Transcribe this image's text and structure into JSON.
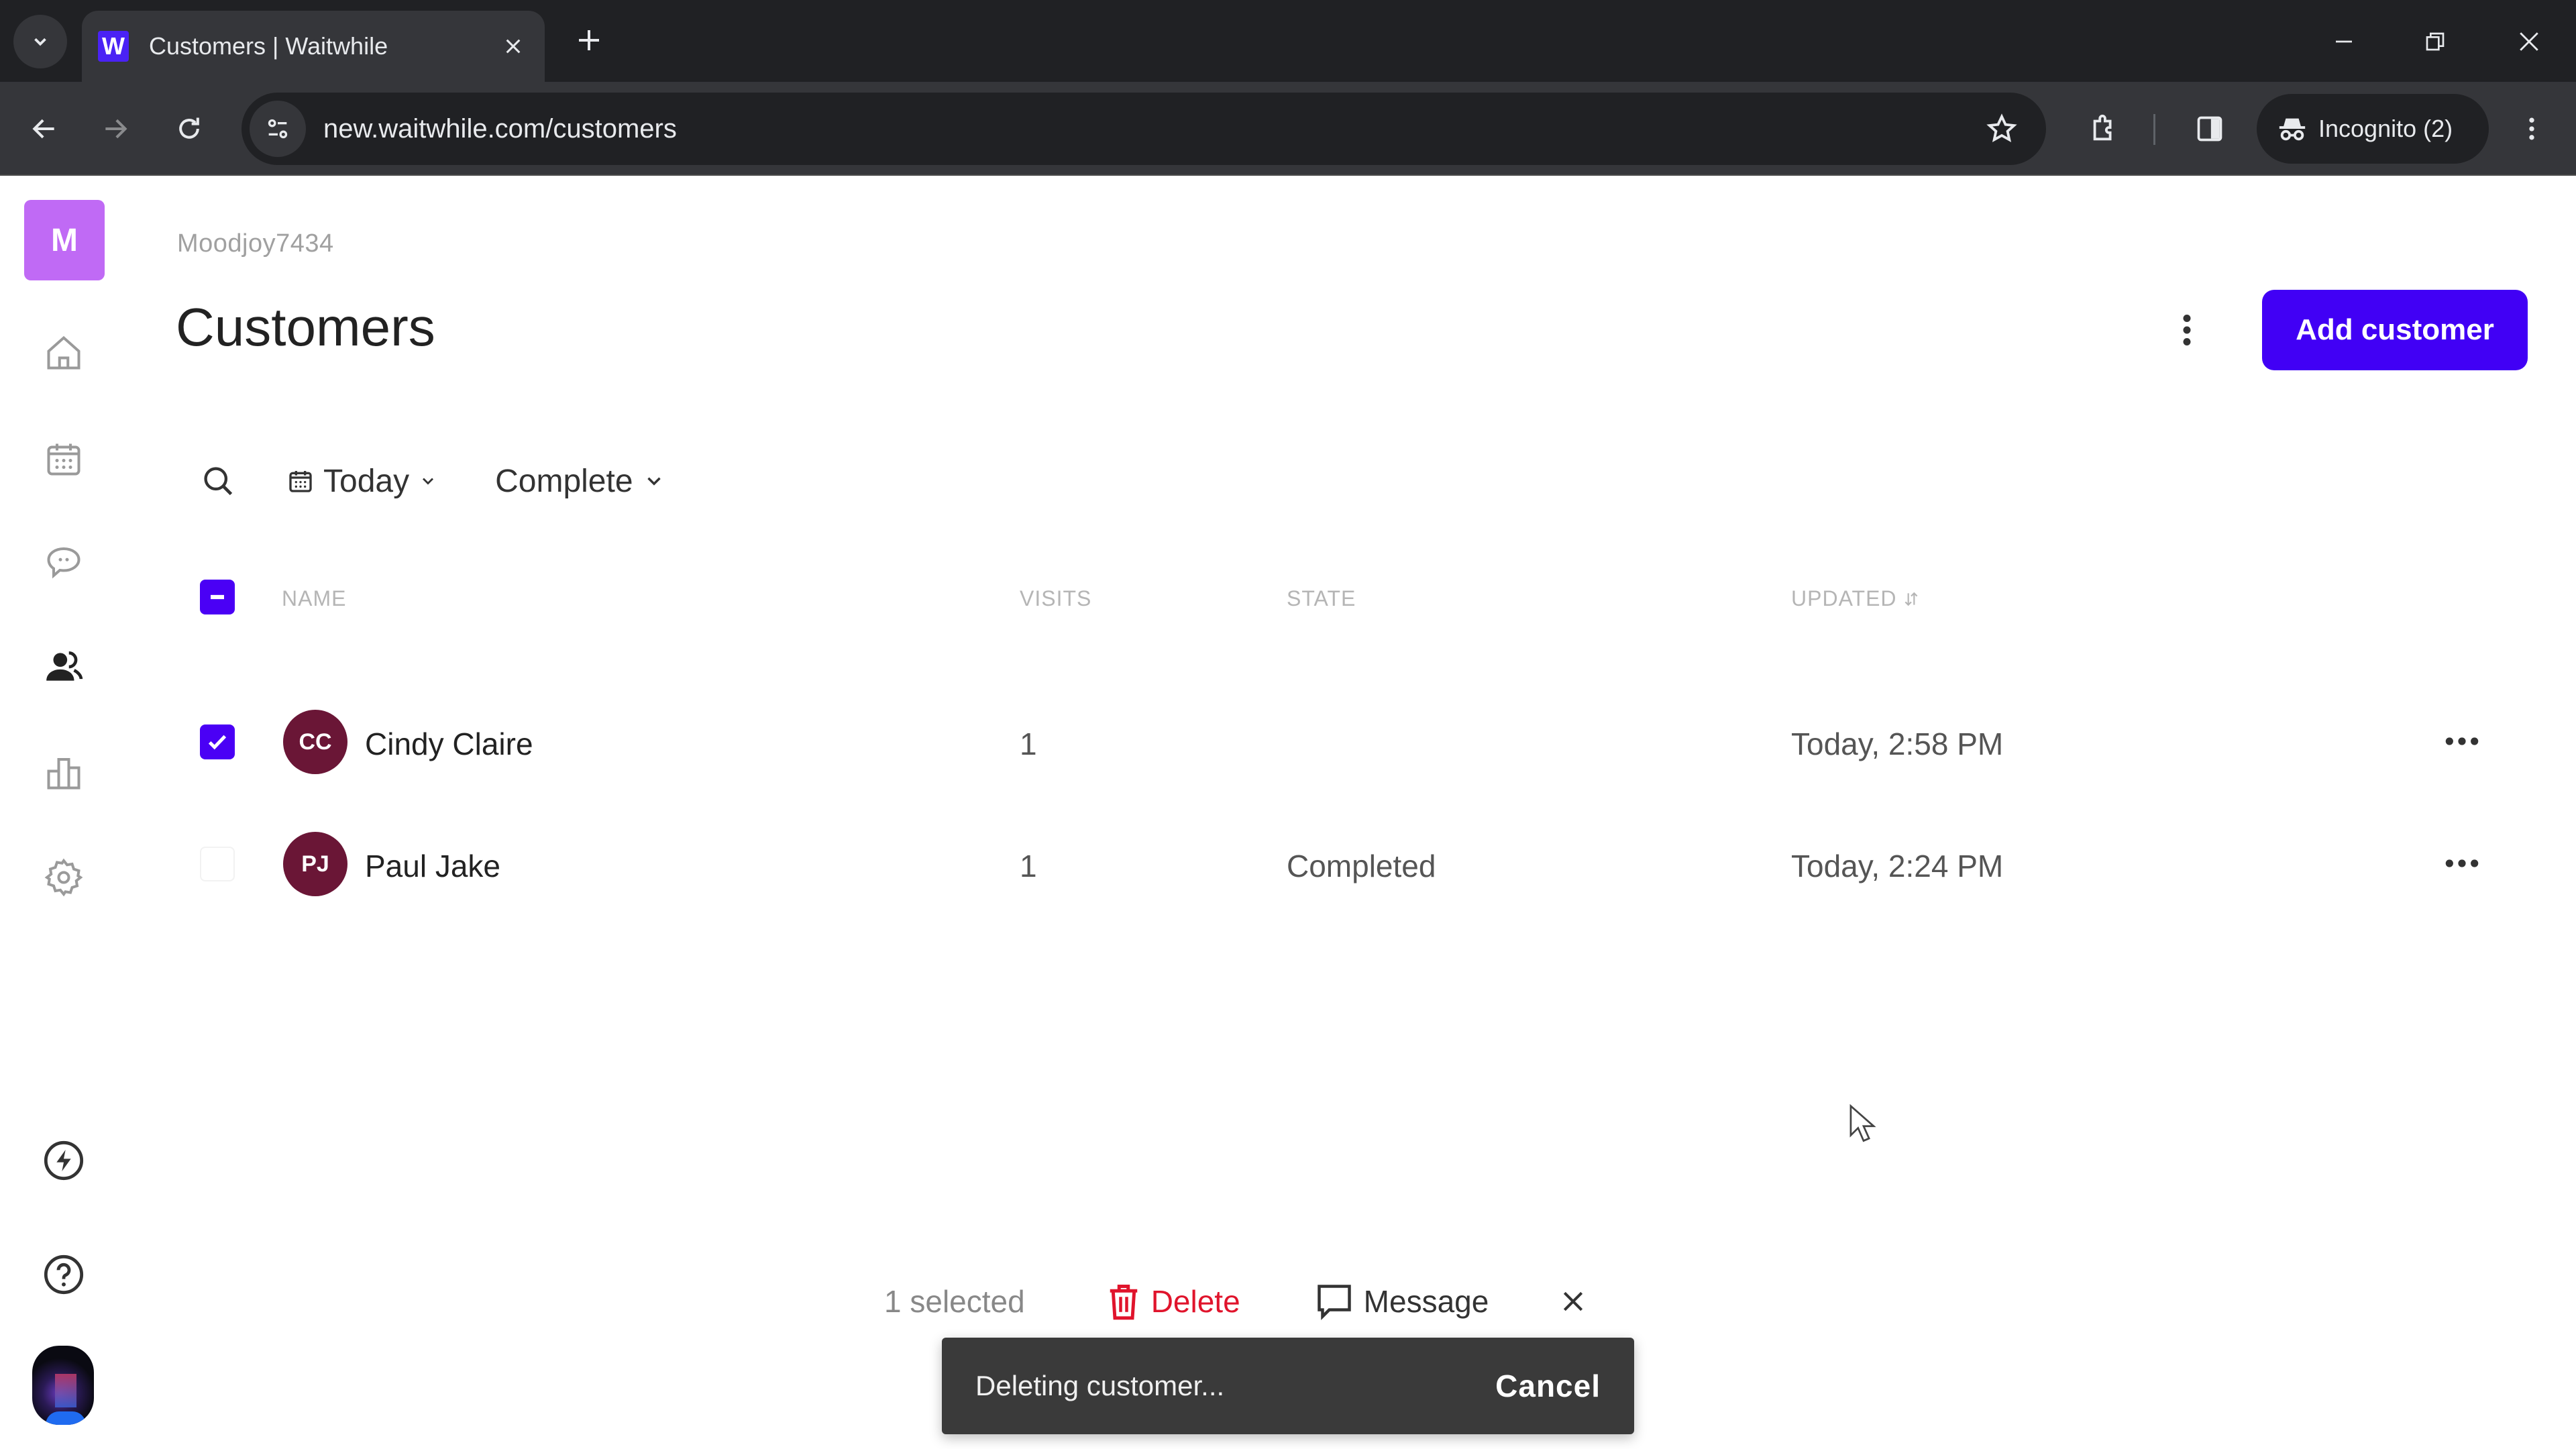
{
  "browser": {
    "tab_title": "Customers | Waitwhile",
    "favicon_letter": "W",
    "url": "new.waitwhile.com/customers",
    "incognito_label": "Incognito (2)"
  },
  "sidebar": {
    "org_initial": "M",
    "items": [
      {
        "name": "home",
        "label": "Home"
      },
      {
        "name": "calendar",
        "label": "Calendar"
      },
      {
        "name": "messages",
        "label": "Messages"
      },
      {
        "name": "customers",
        "label": "Customers",
        "active": true
      },
      {
        "name": "analytics",
        "label": "Analytics"
      },
      {
        "name": "settings",
        "label": "Settings"
      }
    ],
    "bottom_items": [
      {
        "name": "whats-new",
        "label": "What's new"
      },
      {
        "name": "help",
        "label": "Help"
      }
    ]
  },
  "header": {
    "org_name": "Moodjoy7434",
    "title": "Customers",
    "add_button_label": "Add customer"
  },
  "filters": {
    "date_filter": "Today",
    "state_filter": "Complete"
  },
  "table": {
    "columns": {
      "name": "NAME",
      "visits": "VISITS",
      "state": "STATE",
      "updated": "UPDATED"
    },
    "rows": [
      {
        "initials": "CC",
        "name": "Cindy Claire",
        "visits": "1",
        "state": "",
        "updated": "Today, 2:58 PM",
        "selected": true
      },
      {
        "initials": "PJ",
        "name": "Paul Jake",
        "visits": "1",
        "state": "Completed",
        "updated": "Today, 2:24 PM",
        "selected": false
      }
    ]
  },
  "bulk_actions": {
    "selected_count": "1 selected",
    "delete_label": "Delete",
    "message_label": "Message"
  },
  "toast": {
    "message": "Deleting customer...",
    "cancel_label": "Cancel"
  },
  "colors": {
    "brand": "#4100f5",
    "org_badge": "#c06af5",
    "avatar": "#6a1636",
    "danger": "#e0142c"
  }
}
